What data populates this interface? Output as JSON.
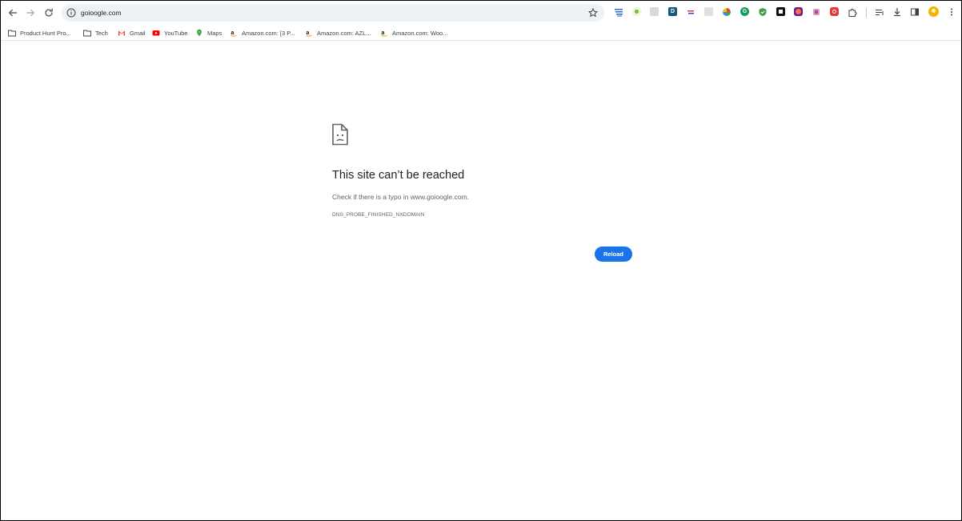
{
  "browser": {
    "url": "goioogle.com"
  },
  "bookmarks": [
    {
      "label": "Product Hunt Pro...",
      "icon": "folder-icon"
    },
    {
      "label": "Tech",
      "icon": "folder-icon"
    },
    {
      "label": "Gmail",
      "icon": "gmail-icon"
    },
    {
      "label": "YouTube",
      "icon": "youtube-icon"
    },
    {
      "label": "Maps",
      "icon": "maps-icon"
    },
    {
      "label": "Amazon.com: [3 P...",
      "icon": "amazon-icon"
    },
    {
      "label": "Amazon.com: AZL...",
      "icon": "amazon-icon"
    },
    {
      "label": "Amazon.com: Woo...",
      "icon": "amazon-icon"
    }
  ],
  "error": {
    "title": "This site can’t be reached",
    "message": "Check if there is a typo in www.goioogle.com.",
    "code": "DNS_PROBE_FINISHED_NXDOMAIN",
    "reload_label": "Reload"
  },
  "colors": {
    "accent": "#1a73e8",
    "omnibox_bg": "#eef1f6"
  }
}
